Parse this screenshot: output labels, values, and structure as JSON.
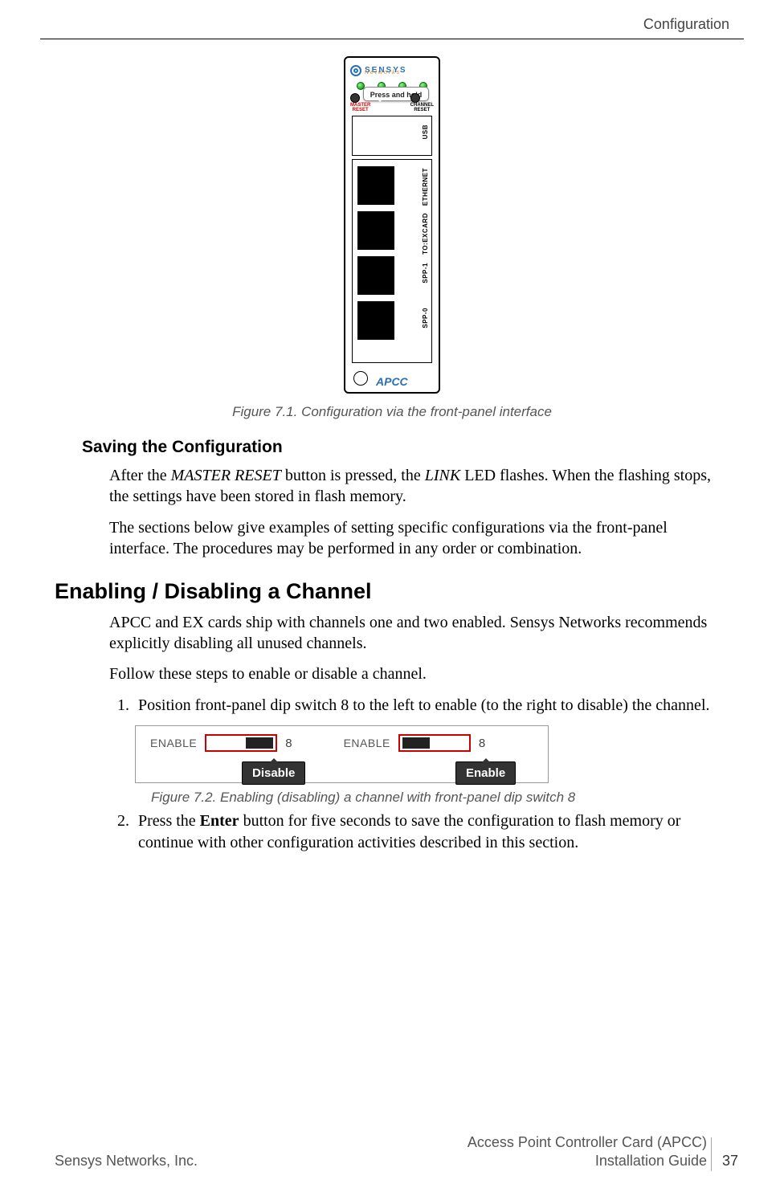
{
  "header": {
    "section": "Configuration"
  },
  "figure1": {
    "caption": "Figure 7.1. Configuration via the front-panel interface",
    "callout": "Press and hold",
    "logo_main": "SENSYS",
    "logo_sub": "Networks",
    "master_reset": "MASTER\nRESET",
    "channel_reset": "CHANNEL\nRESET",
    "ports": {
      "usb": "USB",
      "ethernet": "ETHERNET",
      "excard": "TO:EXCARD",
      "spp1": "SPP-1",
      "spp0": "SPP-0"
    },
    "brand": "APCC"
  },
  "h_saving": "Saving the Configuration",
  "p_saving_1a": "After the ",
  "p_saving_1b": "MASTER RESET",
  "p_saving_1c": " button is pressed, the ",
  "p_saving_1d": "LINK",
  "p_saving_1e": " LED flashes. When the flashing stops, the settings have been stored in flash memory.",
  "p_saving_2": "The sections below give examples of setting specific configurations via the front-panel interface. The procedures may be performed in any order or combination.",
  "h_enable": "Enabling / Disabling a Channel",
  "p_enable_1": "APCC and EX cards ship with channels one and two enabled. Sensys Networks recommends explicitly disabling all unused channels.",
  "p_enable_2": "Follow these steps to enable or disable a channel.",
  "step1": "Position front-panel dip switch 8 to the left to enable (to the right to disable) the channel.",
  "figure2": {
    "caption": "Figure 7.2. Enabling (disabling) a channel with front-panel dip switch 8",
    "enable_label": "ENABLE",
    "switch_num": "8",
    "tag_disable": "Disable",
    "tag_enable": "Enable"
  },
  "step2a": "Press the ",
  "step2b": "Enter",
  "step2c": " button for five seconds to save the configuration to flash memory or continue with other configuration activities described in this section.",
  "footer": {
    "left": "Sensys Networks, Inc.",
    "right1": "Access Point Controller Card (APCC)",
    "right2": "Installation Guide",
    "page": "37"
  }
}
